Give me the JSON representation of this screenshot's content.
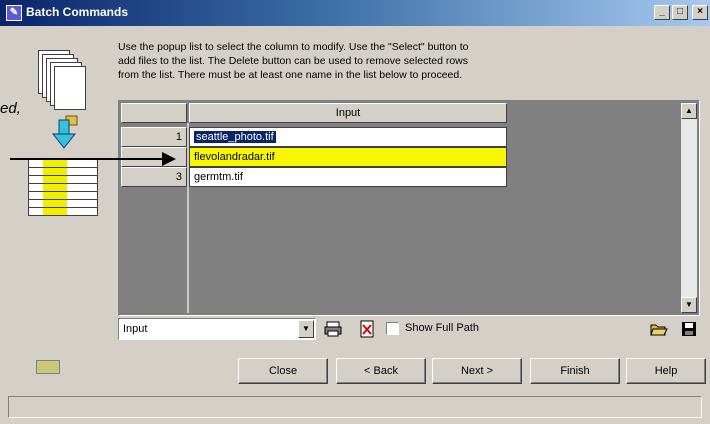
{
  "window": {
    "title": "Batch Commands",
    "controls": [
      "_",
      "□",
      "×"
    ]
  },
  "instructions": "Use the popup list to select the column to modify. Use the \"Select\" button to\nadd files to the list. The Delete button can be used to remove selected rows\nfrom the list. There must be at least one name in the list below to proceed.",
  "annotation_fragment": "ed,",
  "table": {
    "column_header": "Input",
    "rows": [
      {
        "num": "1",
        "value": "seattle_photo.tif"
      },
      {
        "num": "",
        "value": "flevolandradar.tif"
      },
      {
        "num": "3",
        "value": "germtm.tif"
      }
    ]
  },
  "column_select": {
    "value": "Input"
  },
  "show_full_path": {
    "label": "Show Full Path",
    "checked": false
  },
  "buttons": {
    "close": "Close",
    "back": "< Back",
    "next": "Next >",
    "finish": "Finish",
    "help": "Help"
  },
  "colors": {
    "title_start": "#0a246a",
    "title_end": "#a6caf0",
    "row_highlight": "#f7f700",
    "selection": "#0a246a",
    "dialog_bg": "#d4d0c8"
  }
}
